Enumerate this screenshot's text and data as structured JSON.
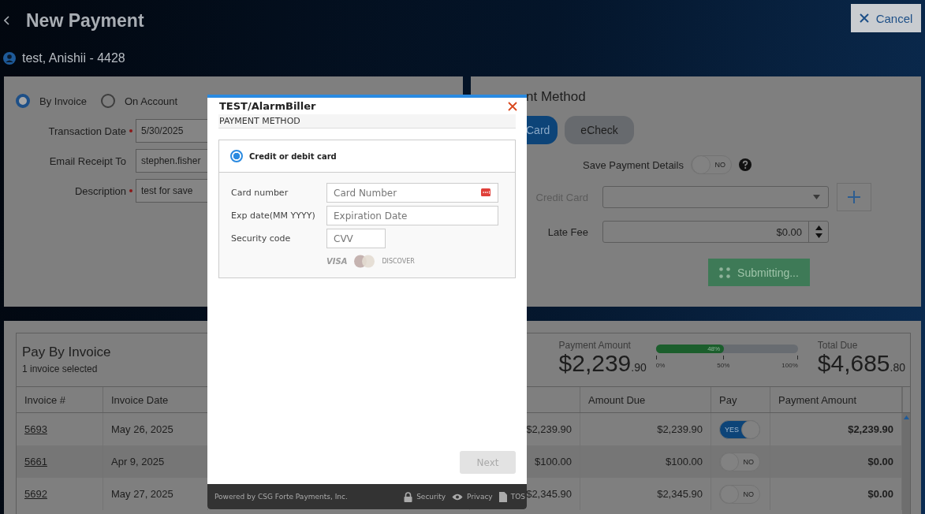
{
  "header": {
    "title": "New Payment",
    "cancel_button": "Cancel",
    "customer": "test, Anishii - 4428"
  },
  "payment_for": {
    "options": [
      {
        "label": "By Invoice",
        "selected": true
      },
      {
        "label": "On Account",
        "selected": false
      }
    ],
    "fields": [
      {
        "label": "Transaction Date",
        "required": true,
        "value": "5/30/2025"
      },
      {
        "label": "Email Receipt To",
        "required": false,
        "value": "stephen.fisher"
      },
      {
        "label": "Description",
        "required": true,
        "value": "test for save"
      }
    ]
  },
  "payment_method": {
    "title": "nt Method",
    "methods": [
      {
        "label": "Card",
        "selected": true
      },
      {
        "label": "eCheck",
        "selected": false
      }
    ],
    "save_details": {
      "label": "Save Payment Details",
      "on": false,
      "state_text": "NO"
    },
    "credit_card": {
      "label": "Credit Card",
      "disabled": true
    },
    "late_fee": {
      "label": "Late Fee",
      "value": "$0.00"
    },
    "submit_button": "Submitting..."
  },
  "invoices": {
    "title": "Pay By Invoice",
    "subtitle": "1 invoice selected",
    "payment_amount": {
      "label": "Payment Amount",
      "amount": "$2,239",
      "cents": ".90"
    },
    "progress": {
      "level": 0.48,
      "reading": "48%",
      "ticks": [
        "0%",
        "50%",
        "100%"
      ]
    },
    "total_due": {
      "label": "Total Due",
      "amount": "$4,685",
      "cents": ".80"
    },
    "columns": {
      "invoice": "Invoice #",
      "invoice_date": "Invoice Date",
      "amount_due": "Amount Due",
      "pay": "Pay",
      "payment_amount": "Payment Amount"
    },
    "rows": [
      {
        "invoice": "5693",
        "invoice_date": "May 26, 2025",
        "column_3": "$2,239.90",
        "amount_due": "$2,239.90",
        "pay": true,
        "pay_text": "YES",
        "payment_amount": "$2,239.90"
      },
      {
        "invoice": "5661",
        "invoice_date": "Apr 9, 2025",
        "column_3": "$100.00",
        "amount_due": "$100.00",
        "pay": false,
        "pay_text": "NO",
        "payment_amount": "$0.00"
      },
      {
        "invoice": "5692",
        "invoice_date": "May 27, 2025",
        "column_3": "$2,345.90",
        "amount_due": "$2,345.90",
        "pay": false,
        "pay_text": "NO",
        "payment_amount": "$0.00"
      }
    ]
  },
  "dialog": {
    "title": "TEST/AlarmBiller",
    "subtitle": "PAYMENT METHOD",
    "option": {
      "label": "Credit or debit card",
      "selected": true
    },
    "fields": [
      {
        "kind": "card",
        "label": "Card number",
        "placeholder": "Card Number"
      },
      {
        "kind": "wide",
        "label": "Exp date(MM YYYY)",
        "placeholder": "Expiration Date"
      },
      {
        "kind": "short",
        "label": "Security code",
        "placeholder": "CVV"
      }
    ],
    "card_logos": {
      "visa": "VISA",
      "discover": "DISCOVER"
    },
    "next_button": {
      "label": "Next",
      "disabled": true
    },
    "footer": {
      "powered_by": "Powered by CSG Forte Payments, Inc.",
      "links": [
        {
          "kind": "lock",
          "label": "Security"
        },
        {
          "kind": "eye",
          "label": "Privacy"
        },
        {
          "kind": "doc",
          "label": "TOS"
        }
      ]
    }
  }
}
